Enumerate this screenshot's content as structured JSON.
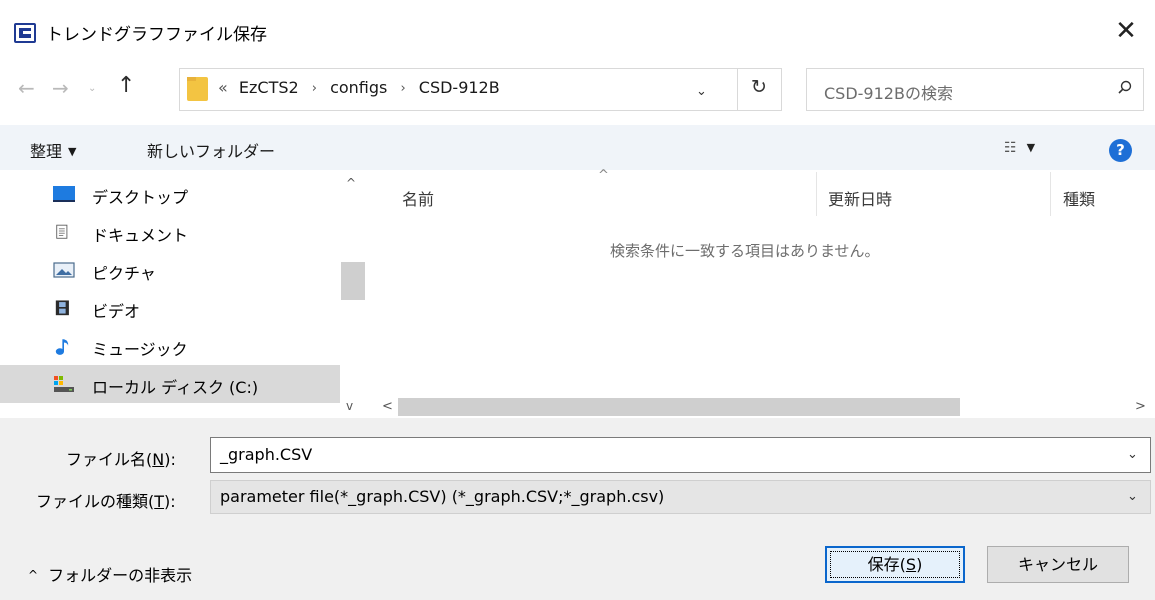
{
  "window": {
    "title": "トレンドグラフファイル保存",
    "close_glyph": "✕"
  },
  "address_bar": {
    "back_glyph": "←",
    "forward_glyph": "→",
    "recent_glyph": "⌄",
    "up_glyph": "↑",
    "overflow_glyph": "«",
    "crumbs": [
      "EzCTS2",
      "configs",
      "CSD-912B"
    ],
    "separator_glyph": "›",
    "dropdown_glyph": "⌄",
    "refresh_glyph": "↻"
  },
  "search": {
    "placeholder": "CSD-912Bの検索"
  },
  "toolbar": {
    "organize_label": "整理",
    "organize_arrow": "▼",
    "new_folder_label": "新しいフォルダー",
    "view_glyph": "☷",
    "view_arrow": "▼",
    "help_glyph": "?"
  },
  "nav_pane": {
    "items": [
      {
        "label": "デスクトップ",
        "icon": "desktop-icon",
        "selected": false
      },
      {
        "label": "ドキュメント",
        "icon": "document-icon",
        "selected": false
      },
      {
        "label": "ピクチャ",
        "icon": "pictures-icon",
        "selected": false
      },
      {
        "label": "ビデオ",
        "icon": "video-icon",
        "selected": false
      },
      {
        "label": "ミュージック",
        "icon": "music-icon",
        "selected": false
      },
      {
        "label": "ローカル ディスク (C:)",
        "icon": "drive-icon",
        "selected": true
      }
    ],
    "scroll_up_glyph": "^",
    "scroll_down_glyph": "v"
  },
  "file_list": {
    "columns": [
      "名前",
      "更新日時",
      "種類"
    ],
    "sort_glyph": "^",
    "empty_message": "検索条件に一致する項目はありません。",
    "scroll_left_glyph": "<",
    "scroll_right_glyph": ">"
  },
  "form": {
    "filename_label": "ファイル名(",
    "filename_hotkey": "N",
    "filename_label_end": "):",
    "filename_value": "_graph.CSV",
    "filetype_label": "ファイルの種類(",
    "filetype_hotkey": "T",
    "filetype_label_end": "):",
    "filetype_value": "parameter file(*_graph.CSV) (*_graph.CSV;*_graph.csv)",
    "dropdown_glyph": "⌄"
  },
  "footer": {
    "hide_folders_glyph": "^",
    "hide_folders_label": "フォルダーの非表示",
    "save_label": "保存(",
    "save_hotkey": "S",
    "save_label_end": ")",
    "cancel_label": "キャンセル"
  },
  "colors": {
    "toolbar_bg": "#f0f4f9",
    "accent": "#0a66cc",
    "help_icon": "#1e6fd6",
    "folder_yellow": "#f3c442",
    "selected_bg": "#d9d9d9"
  }
}
